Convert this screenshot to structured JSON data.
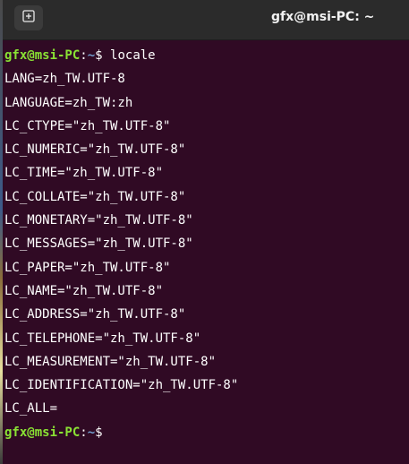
{
  "window": {
    "title": "gfx@msi-PC: ~"
  },
  "icons": {
    "new_tab": "new-tab-plus-icon"
  },
  "colors": {
    "terminal_bg": "#300a24",
    "prompt_user": "#8ae234",
    "prompt_path": "#729fcf",
    "titlebar_bg": "#2b2b2b"
  },
  "prompt": {
    "user_host": "gfx@msi-PC",
    "colon": ":",
    "path": "~",
    "symbol": "$ "
  },
  "command": "locale",
  "output": [
    "LANG=zh_TW.UTF-8",
    "LANGUAGE=zh_TW:zh",
    "LC_CTYPE=\"zh_TW.UTF-8\"",
    "LC_NUMERIC=\"zh_TW.UTF-8\"",
    "LC_TIME=\"zh_TW.UTF-8\"",
    "LC_COLLATE=\"zh_TW.UTF-8\"",
    "LC_MONETARY=\"zh_TW.UTF-8\"",
    "LC_MESSAGES=\"zh_TW.UTF-8\"",
    "LC_PAPER=\"zh_TW.UTF-8\"",
    "LC_NAME=\"zh_TW.UTF-8\"",
    "LC_ADDRESS=\"zh_TW.UTF-8\"",
    "LC_TELEPHONE=\"zh_TW.UTF-8\"",
    "LC_MEASUREMENT=\"zh_TW.UTF-8\"",
    "LC_IDENTIFICATION=\"zh_TW.UTF-8\"",
    "LC_ALL="
  ]
}
